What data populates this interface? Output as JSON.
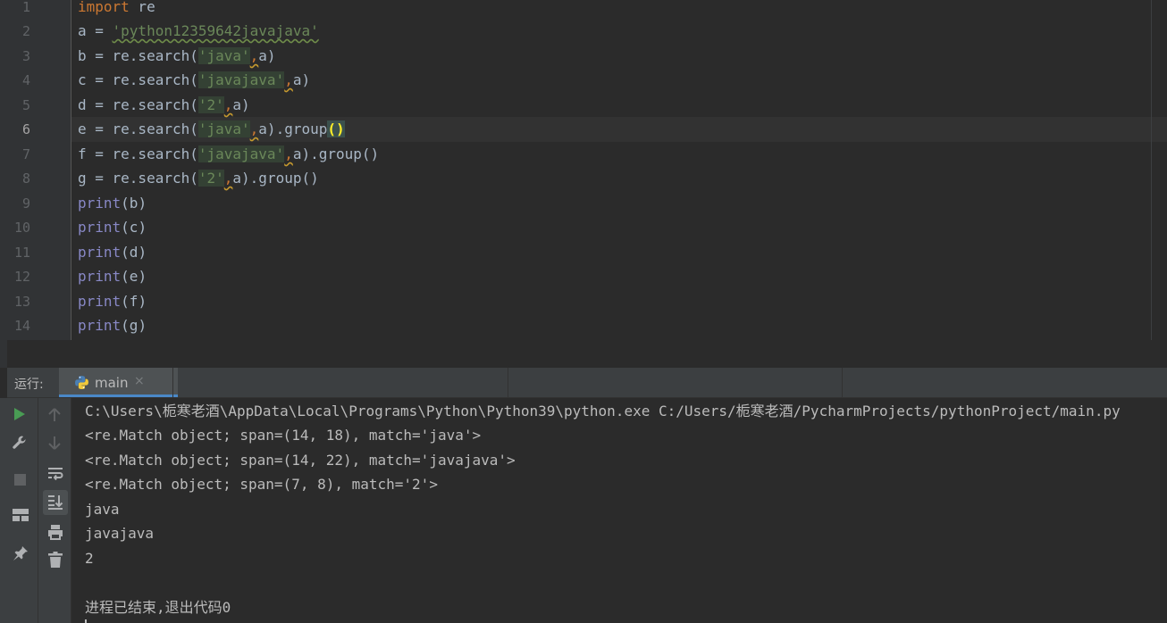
{
  "editor": {
    "line_numbers": [
      "1",
      "2",
      "3",
      "4",
      "5",
      "6",
      "7",
      "8",
      "9",
      "10",
      "11",
      "12",
      "13",
      "14"
    ],
    "current_line": "6",
    "lines": {
      "l1": {
        "kw": "import",
        "rest": " re"
      },
      "l2": {
        "pre": "a = ",
        "str": "'python12359642javajava'"
      },
      "l3": {
        "pre": "b = re.search(",
        "str": "'java'",
        "comma": ",",
        "post": "a)"
      },
      "l4": {
        "pre": "c = re.search(",
        "str": "'javajava'",
        "comma": ",",
        "post": "a)"
      },
      "l5": {
        "pre": "d = re.search(",
        "str": "'2'",
        "comma": ",",
        "post": "a)"
      },
      "l6": {
        "pre": "e = re.search(",
        "str": "'java'",
        "comma": ",",
        "post": "a).group",
        "brace": "()"
      },
      "l7": {
        "pre": "f = re.search(",
        "str": "'javajava'",
        "comma": ",",
        "post": "a).group()"
      },
      "l8": {
        "pre": "g = re.search(",
        "str": "'2'",
        "comma": ",",
        "post": "a).group()"
      },
      "l9": {
        "fn": "print",
        "args": "(b)"
      },
      "l10": {
        "fn": "print",
        "args": "(c)"
      },
      "l11": {
        "fn": "print",
        "args": "(d)"
      },
      "l12": {
        "fn": "print",
        "args": "(e)"
      },
      "l13": {
        "fn": "print",
        "args": "(f)"
      },
      "l14": {
        "fn": "print",
        "args": "(g)"
      }
    }
  },
  "run_panel": {
    "label": "运行:",
    "tab_label": "main",
    "tab_close": "×",
    "output": [
      "C:\\Users\\栀寒老酒\\AppData\\Local\\Programs\\Python\\Python39\\python.exe C:/Users/栀寒老酒/PycharmProjects/pythonProject/main.py",
      "<re.Match object; span=(14, 18), match='java'>",
      "<re.Match object; span=(14, 22), match='javajava'>",
      "<re.Match object; span=(7, 8), match='2'>",
      "java",
      "javajava",
      "2",
      "",
      "进程已结束,退出代码0"
    ],
    "toolbar_icons": [
      "rerun-icon",
      "wrench-icon",
      "stop-icon",
      "layout-icon",
      "pin-icon",
      "up-arrow-icon",
      "down-arrow-icon",
      "soft-wrap-icon",
      "scroll-to-end-icon",
      "print-icon",
      "trash-icon"
    ]
  },
  "colors": {
    "background": "#2b2b2b",
    "keyword": "#cc7832",
    "string": "#6a8759",
    "builtin": "#8888c6",
    "text": "#a9b7c6",
    "run_green": "#499c54",
    "tab_underline": "#4a88c7"
  }
}
